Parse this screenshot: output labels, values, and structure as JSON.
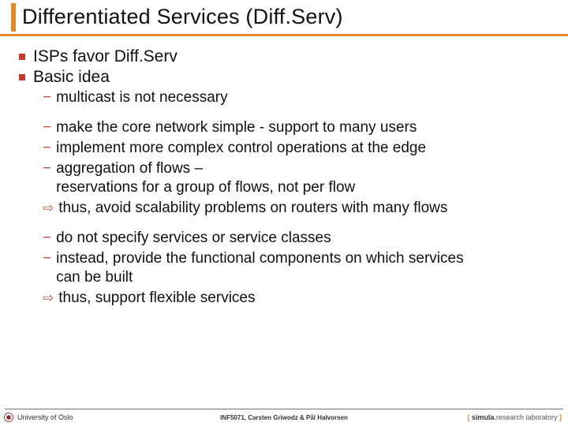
{
  "title": "Differentiated Services (Diff.Serv)",
  "bullets": {
    "b1": "ISPs favor Diff.Serv",
    "b2": "Basic idea",
    "s1": "multicast is not necessary",
    "s2": "make the core network simple - support to many users",
    "s3": "implement more complex control operations at the edge",
    "s4a": "aggregation of flows –",
    "s4b": "reservations for a group of flows, not per flow",
    "s5": "thus, avoid scalability problems on routers with many flows",
    "s6": "do not specify services or service classes",
    "s7a": "instead, provide the functional components on which services",
    "s7b": "can be built",
    "s8": "thus, support flexible services"
  },
  "footer": {
    "uio": "University of Oslo",
    "course": "INF5071, Carsten Griwodz & Pål Halvorsen",
    "simula_pre": "[ ",
    "simula_bold": "simula",
    "simula_dot": ".",
    "simula_rest": "research laboratory",
    "simula_post": " ]"
  }
}
